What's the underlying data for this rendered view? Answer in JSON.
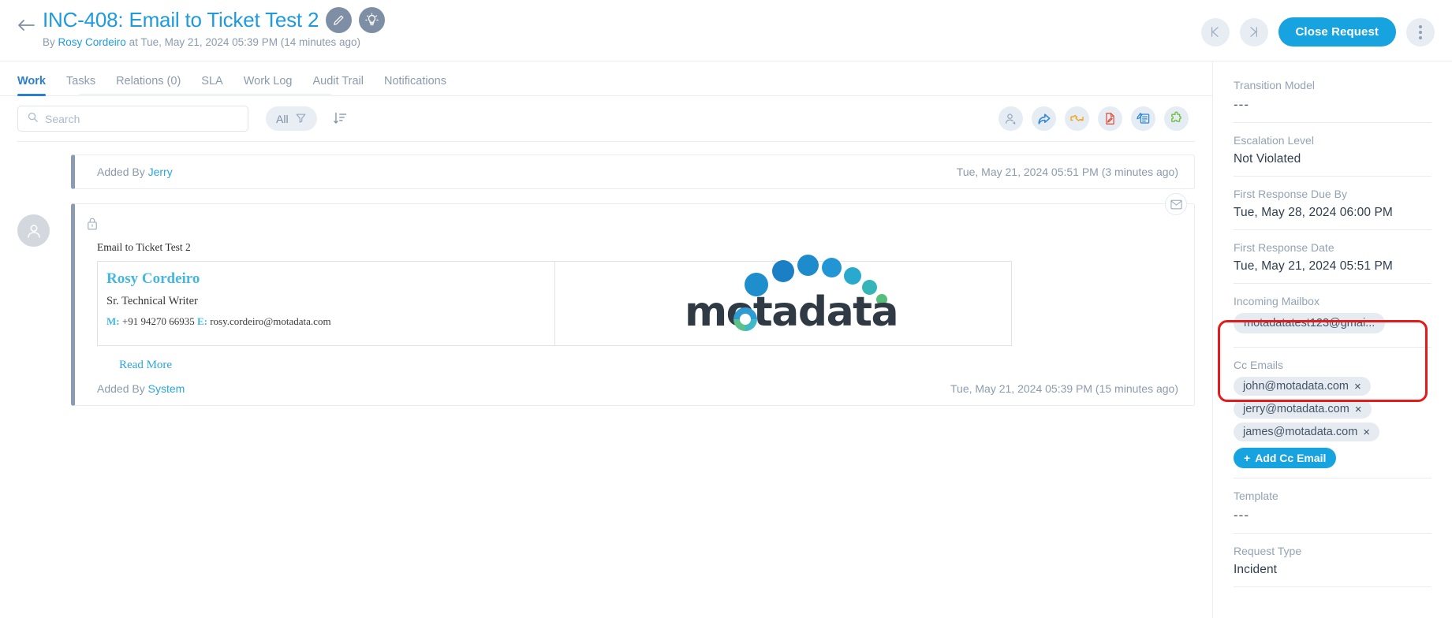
{
  "header": {
    "back_icon": "arrow-left-icon",
    "title": "INC-408: Email to Ticket Test 2",
    "edit_icon": "pencil-icon",
    "insight_icon": "lightbulb-icon",
    "byline_prefix": "By",
    "author": "Rosy Cordeiro",
    "byline_suffix": "at Tue, May 21, 2024 05:39 PM (14 minutes ago)",
    "prev_label": "previous-request",
    "next_label": "next-request",
    "close_request_label": "Close Request",
    "more_label": "more-options",
    "accent_color": "#17a2e0",
    "title_color": "#1f9bdd"
  },
  "tabs": [
    {
      "label": "Work",
      "active": true
    },
    {
      "label": "Tasks",
      "active": false
    },
    {
      "label": "Relations (0)",
      "active": false
    },
    {
      "label": "SLA",
      "active": false
    },
    {
      "label": "Work Log",
      "active": false
    },
    {
      "label": "Audit Trail",
      "active": false
    },
    {
      "label": "Notifications",
      "active": false
    }
  ],
  "filterbar": {
    "search_placeholder": "Search",
    "search_value": "",
    "filter_label": "All",
    "sort_label": "sort-descending",
    "tools": [
      {
        "name": "add-watcher-icon",
        "color": "#8fa3b8"
      },
      {
        "name": "forward-icon",
        "color": "#2f86d6"
      },
      {
        "name": "handshake-icon",
        "color": "#f0a81e"
      },
      {
        "name": "document-edit-icon",
        "color": "#e04b3a"
      },
      {
        "name": "note-pen-icon",
        "color": "#2f86d6"
      },
      {
        "name": "puzzle-icon",
        "color": "#6cbf3a"
      }
    ]
  },
  "feed": [
    {
      "type": "note",
      "added_by_label": "Added By",
      "added_by_user": "Jerry",
      "timestamp": "Tue, May 21, 2024 05:51 PM (3 minutes ago)"
    },
    {
      "type": "email",
      "channel_icon": "envelope-icon",
      "lock_icon": "lock-icon",
      "avatar_icon": "user-avatar-icon",
      "subject": "Email to Ticket Test 2",
      "signature": {
        "name": "Rosy Cordeiro",
        "role": "Sr. Technical Writer",
        "mobile_label": "M:",
        "mobile": "+91 94270 66935",
        "email_label": "E:",
        "email": "rosy.cordeiro@motadata.com",
        "logo_text": "motadata"
      },
      "read_more_label": "Read More",
      "added_by_label": "Added By",
      "added_by_user": "System",
      "timestamp": "Tue, May 21, 2024 05:39 PM (15 minutes ago)"
    }
  ],
  "sidebar": {
    "fields": [
      {
        "label": "Transition Model",
        "value": "---",
        "kind": "dash"
      },
      {
        "label": "Escalation Level",
        "value": "Not Violated",
        "kind": "text"
      },
      {
        "label": "First Response Due By",
        "value": "Tue, May 28, 2024 06:00 PM",
        "kind": "text"
      },
      {
        "label": "First Response Date",
        "value": "Tue, May 21, 2024 05:51 PM",
        "kind": "text"
      },
      {
        "label": "Incoming Mailbox",
        "value": "motadatatest123@gmai...",
        "kind": "pill"
      }
    ],
    "cc": {
      "label": "Cc Emails",
      "emails": [
        "john@motadata.com",
        "jerry@motadata.com",
        "james@motadata.com"
      ],
      "remove_glyph": "×",
      "add_label": "Add Cc Email",
      "add_glyph": "+",
      "highlight_color": "#e51b1b"
    },
    "fields_after": [
      {
        "label": "Template",
        "value": "---",
        "kind": "dash"
      },
      {
        "label": "Request Type",
        "value": "Incident",
        "kind": "text"
      }
    ]
  }
}
